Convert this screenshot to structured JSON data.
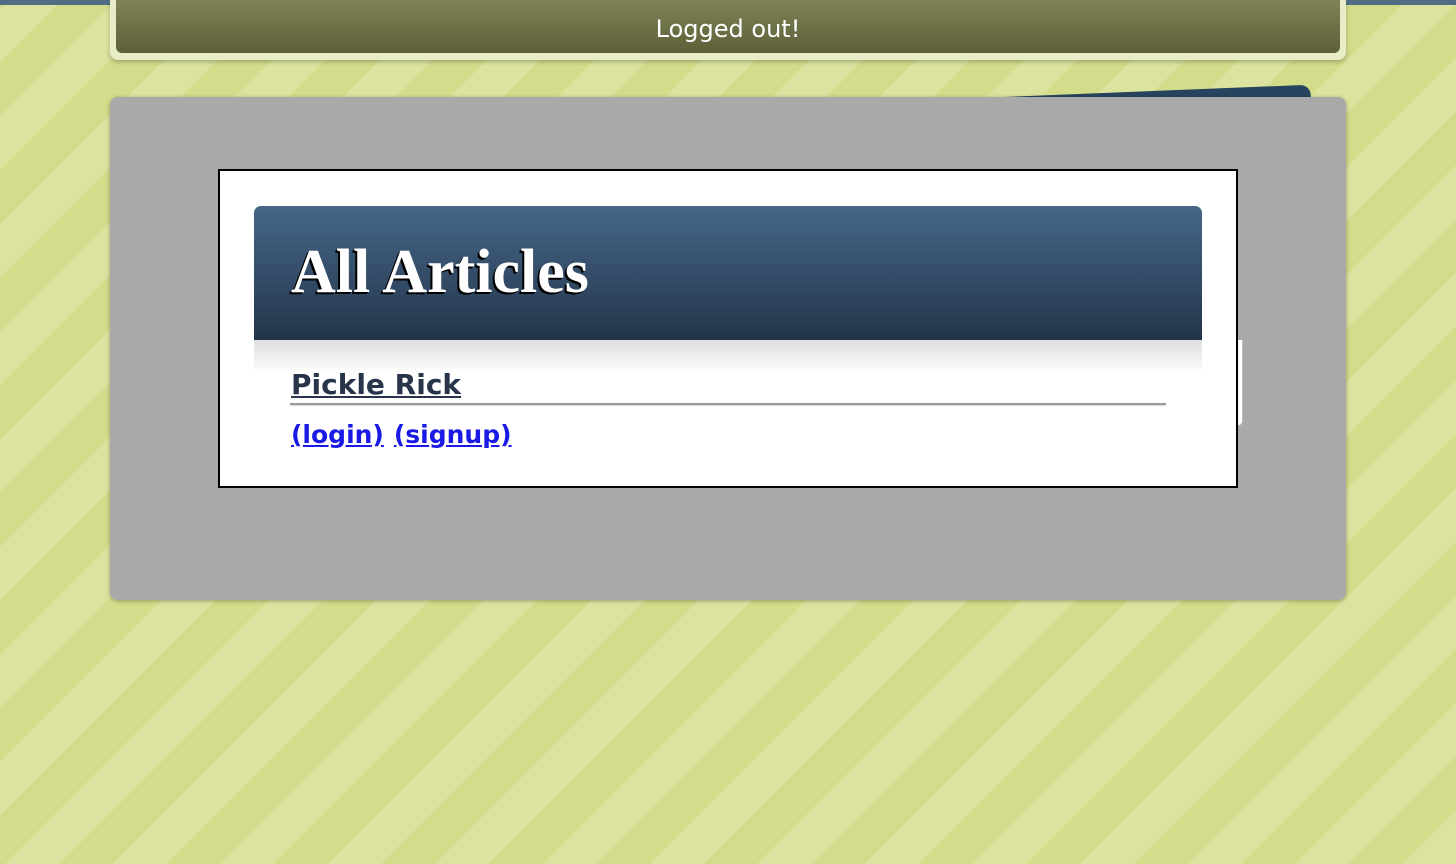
{
  "flash": {
    "message": "Logged out!"
  },
  "articles": {
    "heading": "All Articles",
    "items": [
      {
        "title": "Pickle Rick"
      }
    ]
  },
  "auth": {
    "login_label": "(login)",
    "signup_label": "(signup)",
    "link_color": "#1a1ae6"
  },
  "theme": {
    "header_gradient_top": "#466789",
    "header_gradient_bottom": "#233449",
    "panel_color": "#a9a9a9",
    "background_stripe_light": "#dbe39f",
    "background_stripe_dark": "#d2dc8a"
  }
}
